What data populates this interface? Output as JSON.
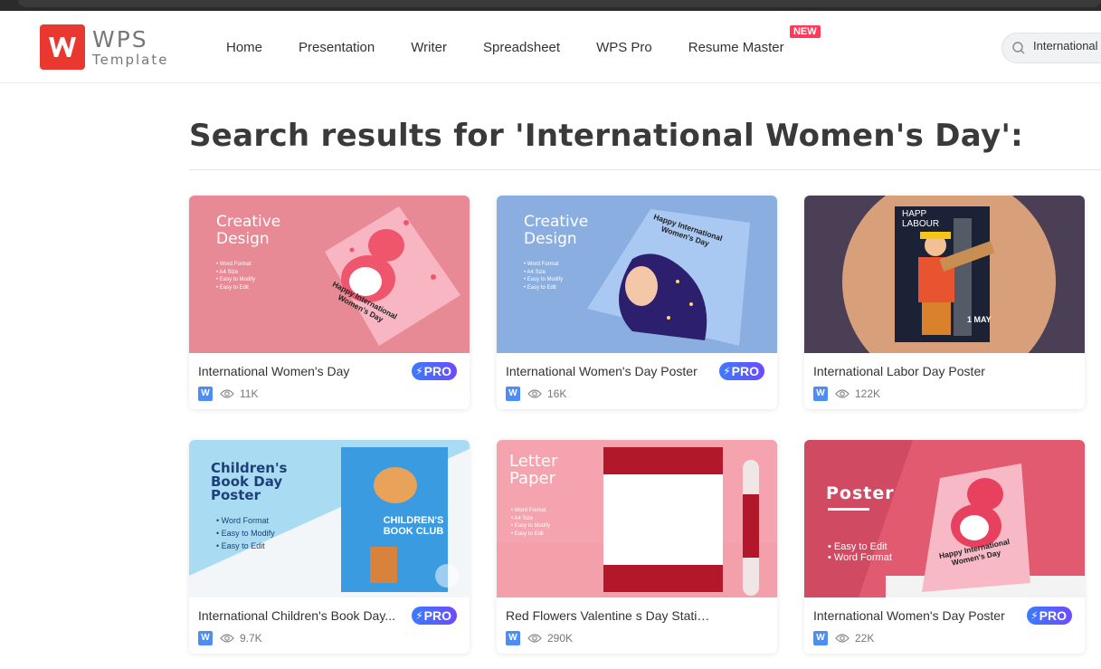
{
  "header": {
    "logo_main": "WPS",
    "logo_sub": "Template",
    "nav": [
      {
        "label": "Home"
      },
      {
        "label": "Presentation"
      },
      {
        "label": "Writer"
      },
      {
        "label": "Spreadsheet"
      },
      {
        "label": "WPS Pro"
      },
      {
        "label": "Resume Master",
        "badge": "NEW"
      }
    ],
    "search_value": "International"
  },
  "page_title": "Search results for 'International Women's Day':",
  "cards": [
    {
      "title": "International Women's Day",
      "views": "11K",
      "pro": "PRO",
      "thumb_text": [
        "Creative",
        "Design"
      ],
      "thumb_bullets": [
        "• Word Format",
        "• A4 Size",
        "• Easy to Modify",
        "• Easy to Edit"
      ],
      "poster_text": "Happy International Women's Day"
    },
    {
      "title": "International Women's Day Poster",
      "views": "16K",
      "pro": "PRO",
      "thumb_text": [
        "Creative",
        "Design"
      ],
      "thumb_bullets": [
        "• Word Format",
        "• A4 Size",
        "• Easy to Modify",
        "• Easy to Edit"
      ],
      "poster_text": "Happy International Women's Day"
    },
    {
      "title": "International Labor Day Poster",
      "views": "122K",
      "pro": "",
      "thumb_text": [
        "HAPP",
        "LABOUR"
      ],
      "poster_text": "1 MAY"
    },
    {
      "title": "International Children's Book Day...",
      "views": "9.7K",
      "pro": "PRO",
      "thumb_text": [
        "Children's",
        "Book Day",
        "Poster"
      ],
      "thumb_bullets": [
        "• Word Format",
        "• Easy to Modify",
        "• Easy to Edit"
      ],
      "poster_text": "CHILDREN'S BOOK CLUB"
    },
    {
      "title": "Red Flowers Valentine s Day Stationery",
      "views": "290K",
      "pro": "",
      "thumb_text": [
        "Letter",
        "Paper"
      ],
      "thumb_bullets": [
        "• Word Format",
        "• A4 Size",
        "• Easy to Modify",
        "• Easy to Edit"
      ]
    },
    {
      "title": "International Women's Day Poster",
      "views": "22K",
      "pro": "PRO",
      "thumb_text": [
        "Poster"
      ],
      "thumb_bullets": [
        "• Easy to Edit",
        "• Word Format"
      ],
      "poster_text": "Happy International Women's Day"
    }
  ],
  "colors": {
    "accent": "#e8382f",
    "pro_gradient_start": "#3b7bff",
    "pro_gradient_end": "#6c4bff",
    "new_badge": "#ff3b5c"
  }
}
